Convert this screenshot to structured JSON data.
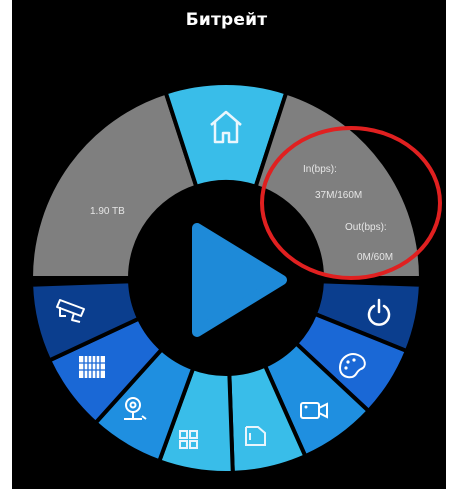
{
  "header": {
    "title": "Битрейт"
  },
  "storage": {
    "value": "1.90 TB"
  },
  "bitrate": {
    "in_label": "In(bps):",
    "in_value": "37M/160M",
    "out_label": "Out(bps):",
    "out_value": "0M/60M"
  },
  "menu": {
    "items": [
      {
        "id": "home",
        "icon": "home-icon"
      },
      {
        "id": "power",
        "icon": "power-icon"
      },
      {
        "id": "theme",
        "icon": "palette-icon"
      },
      {
        "id": "camera",
        "icon": "video-camera-icon"
      },
      {
        "id": "files",
        "icon": "file-folder-icon"
      },
      {
        "id": "layout",
        "icon": "grid-layout-icon"
      },
      {
        "id": "webcam",
        "icon": "webcam-icon"
      },
      {
        "id": "barcode",
        "icon": "barcode-icon"
      },
      {
        "id": "cctv",
        "icon": "cctv-camera-icon"
      }
    ],
    "play": {
      "icon": "play-icon"
    }
  },
  "colors": {
    "background": "#000000",
    "segment_gray": "#7f7f7f",
    "segment_light_blue": "#39bde9",
    "segment_mid_blue": "#1f8fe0",
    "segment_blue": "#1a68d6",
    "segment_dark_blue": "#0b3e8e",
    "play": "#1e8ad8",
    "annotation": "#e02020"
  }
}
